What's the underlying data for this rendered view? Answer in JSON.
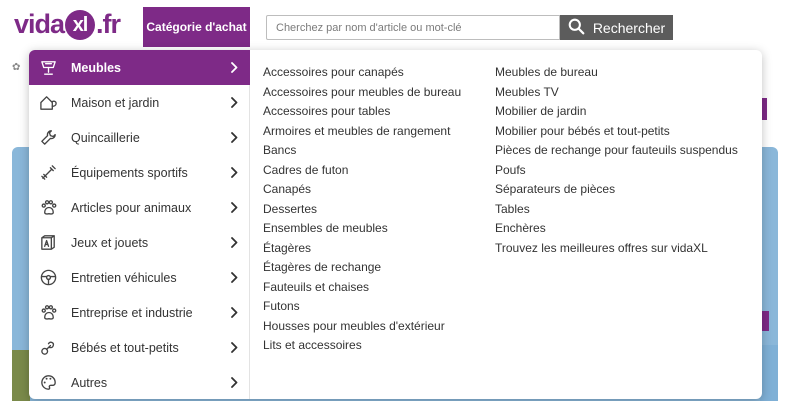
{
  "header": {
    "logo_main": "vida",
    "logo_xl": "xl",
    "logo_tld": ".fr",
    "category_button": "Catégorie d'achat",
    "search_placeholder": "Cherchez par nom d'article ou mot-clé",
    "search_value": "",
    "search_button": "Rechercher",
    "brand_color": "#7e2a87"
  },
  "menu": {
    "categories": [
      {
        "label": "Meubles",
        "icon": "furniture-icon",
        "active": true
      },
      {
        "label": "Maison et jardin",
        "icon": "house-garden-icon",
        "active": false
      },
      {
        "label": "Quincaillerie",
        "icon": "wrench-icon",
        "active": false
      },
      {
        "label": "Équipements sportifs",
        "icon": "dumbbell-icon",
        "active": false
      },
      {
        "label": "Articles pour animaux",
        "icon": "paw-icon",
        "active": false
      },
      {
        "label": "Jeux et jouets",
        "icon": "toy-block-icon",
        "active": false
      },
      {
        "label": "Entretien véhicules",
        "icon": "steering-wheel-icon",
        "active": false
      },
      {
        "label": "Entreprise et industrie",
        "icon": "industry-icon",
        "active": false
      },
      {
        "label": "Bébés et tout-petits",
        "icon": "pacifier-icon",
        "active": false
      },
      {
        "label": "Autres",
        "icon": "palette-icon",
        "active": false
      }
    ],
    "subcategories_col1": [
      "Accessoires pour canapés",
      "Accessoires pour meubles de bureau",
      "Accessoires pour tables",
      "Armoires et meubles de rangement",
      "Bancs",
      "Cadres de futon",
      "Canapés",
      "Dessertes",
      "Ensembles de meubles",
      "Étagères",
      "Étagères de rechange",
      "Fauteuils et chaises",
      "Futons",
      "Housses pour meubles d'extérieur",
      "Lits et accessoires"
    ],
    "subcategories_col2": [
      "Meubles de bureau",
      "Meubles TV",
      "Mobilier de jardin",
      "Mobilier pour bébés et tout-petits",
      "Pièces de rechange pour fauteuils suspendus",
      "Poufs",
      "Séparateurs de pièces",
      "Tables",
      "Enchères",
      "Trouvez les meilleures offres sur vidaXL"
    ]
  }
}
